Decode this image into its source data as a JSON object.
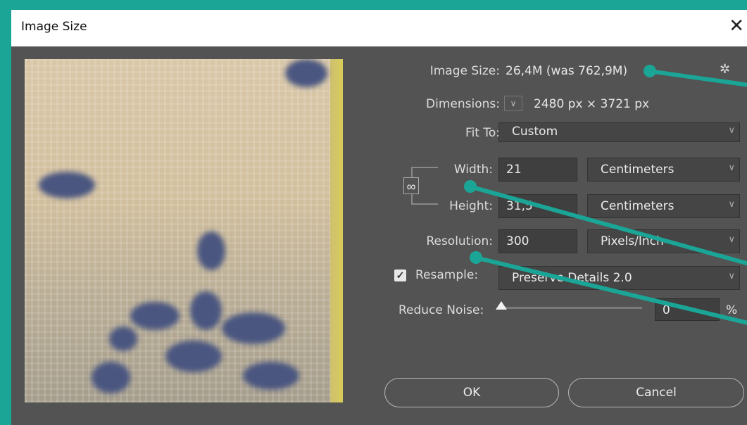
{
  "window": {
    "title": "Image Size",
    "close_glyph": "✕"
  },
  "info": {
    "image_size_label": "Image Size:",
    "image_size_value": "26,4M (was 762,9M)",
    "dimensions_label": "Dimensions:",
    "dimensions_value": "2480 px  ×  3721 px"
  },
  "fit_to": {
    "label": "Fit To:",
    "value": "Custom"
  },
  "width": {
    "label": "Width:",
    "value": "21",
    "unit": "Centimeters"
  },
  "height": {
    "label": "Height:",
    "value": "31,5",
    "unit": "Centimeters"
  },
  "resolution": {
    "label": "Resolution:",
    "value": "300",
    "unit": "Pixels/Inch"
  },
  "resample": {
    "label": "Resample:",
    "checked": true,
    "value": "Preserve Details 2.0"
  },
  "reduce_noise": {
    "label": "Reduce Noise:",
    "value": "0",
    "unit": "%",
    "level": 0
  },
  "buttons": {
    "ok": "OK",
    "cancel": "Cancel"
  },
  "colors": {
    "accent": "#1aa596",
    "dialog_bg": "#535353"
  },
  "icons": {
    "gear": "gear-icon",
    "link": "chain-link-icon",
    "chevron": "chevron-down-icon"
  }
}
